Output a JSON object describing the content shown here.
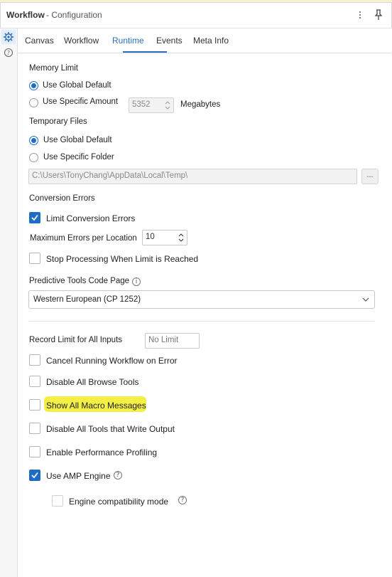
{
  "header": {
    "title": "Workflow",
    "subtitle": "- Configuration",
    "menu_icon": "kebab-menu-icon",
    "pin_icon": "pin-icon"
  },
  "rail": {
    "items": [
      {
        "icon": "gear-icon",
        "active": true
      },
      {
        "icon": "help-icon",
        "active": false
      }
    ]
  },
  "tabs": [
    {
      "label": "Canvas"
    },
    {
      "label": "Workflow"
    },
    {
      "label": "Runtime",
      "active": true
    },
    {
      "label": "Events"
    },
    {
      "label": "Meta Info"
    }
  ],
  "memory": {
    "section": "Memory Limit",
    "option_global": "Use Global Default",
    "option_specific": "Use Specific Amount",
    "amount_value": "5352",
    "unit": "Megabytes"
  },
  "temp_files": {
    "section": "Temporary Files",
    "option_global": "Use Global Default",
    "option_folder": "Use Specific Folder",
    "path_value": "C:\\Users\\TonyChang\\AppData\\Local\\Temp\\",
    "browse_label": "..."
  },
  "conversion": {
    "section": "Conversion Errors",
    "limit_label": "Limit Conversion Errors",
    "max_label": "Maximum Errors per Location",
    "max_value": "10",
    "stop_label": "Stop Processing When Limit is Reached"
  },
  "predictive": {
    "section": "Predictive Tools Code Page",
    "selected": "Western European (CP 1252)"
  },
  "record_limit": {
    "label": "Record Limit for All Inputs",
    "placeholder": "No Limit"
  },
  "options": {
    "cancel_on_error": "Cancel Running Workflow on Error",
    "disable_browse": "Disable All Browse Tools",
    "show_macro": "Show All Macro Messages",
    "disable_output": "Disable All Tools that Write Output",
    "perf_profiling": "Enable Performance Profiling",
    "amp_engine": "Use AMP Engine",
    "engine_compat": "Engine compatibility mode"
  },
  "colors": {
    "accent": "#1f6cc4",
    "highlight": "#f3ef47"
  }
}
